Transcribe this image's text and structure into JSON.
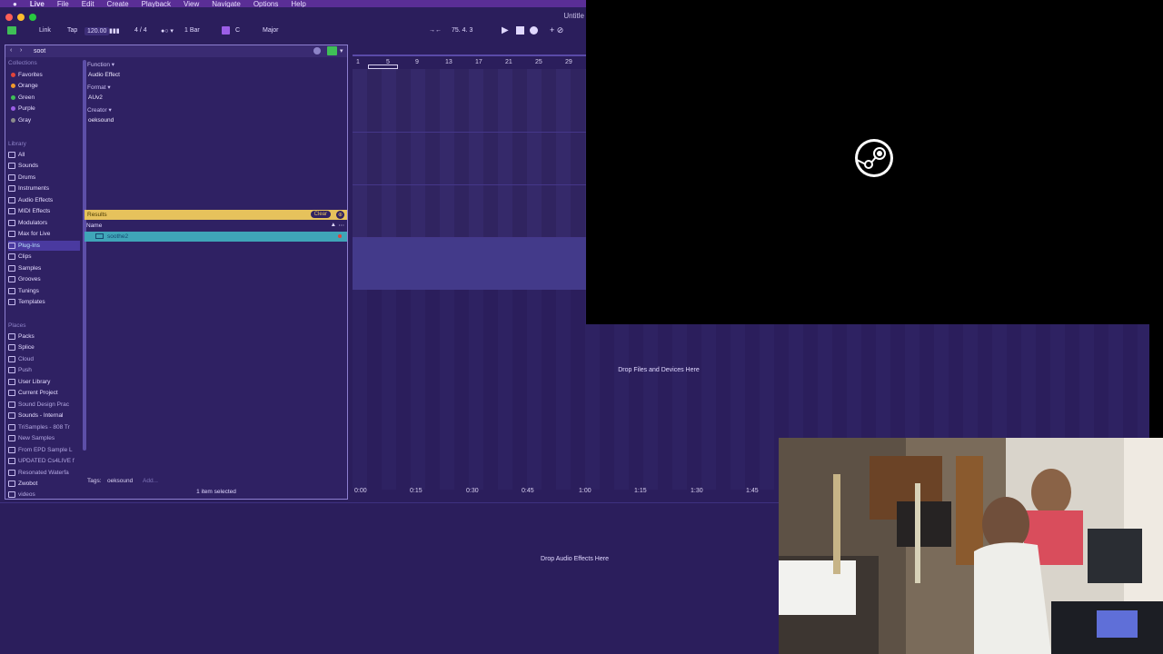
{
  "menubar": {
    "app": "Live",
    "items": [
      "File",
      "Edit",
      "Create",
      "Playback",
      "View",
      "Navigate",
      "Options",
      "Help"
    ]
  },
  "window": {
    "title": "Untitle"
  },
  "transport": {
    "link": "Link",
    "tap": "Tap",
    "tempo": "120.00",
    "signature": "4 / 4",
    "quantize": "1 Bar",
    "key": "C",
    "scale": "Major",
    "position": "75.  4.  3"
  },
  "browser": {
    "search_value": "soot",
    "collections_header": "Collections",
    "collections": [
      {
        "label": "Favorites",
        "color": "#e0443b"
      },
      {
        "label": "Orange",
        "color": "#f09a2c"
      },
      {
        "label": "Green",
        "color": "#3fbf57"
      },
      {
        "label": "Purple",
        "color": "#9b5ee6"
      },
      {
        "label": "Gray",
        "color": "#8b8b8b"
      }
    ],
    "library_header": "Library",
    "library": [
      "All",
      "Sounds",
      "Drums",
      "Instruments",
      "Audio Effects",
      "MIDI Effects",
      "Modulators",
      "Max for Live",
      "Plug-Ins",
      "Clips",
      "Samples",
      "Grooves",
      "Tunings",
      "Templates"
    ],
    "places_header": "Places",
    "places": [
      "Packs",
      "Splice",
      "Cloud",
      "Push",
      "User Library",
      "Current Project",
      "Sound Design Prac",
      "Sounds - Internal",
      "TriSamples - 808 Tr",
      "New Samples",
      "From EPD Sample L",
      "UPDATED Cs4LIVE f",
      "Resonated Waterfa",
      "Zwobot",
      "videos"
    ],
    "filters": {
      "function_label": "Function ▾",
      "function_value": "Audio Effect",
      "format_label": "Format ▾",
      "format_value": "AUv2",
      "creator_label": "Creator ▾",
      "creator_value": "oeksound"
    },
    "results_label": "Results",
    "clear_label": "Clear",
    "column_name": "Name",
    "result_item": "soothe2",
    "tags_label": "Tags:",
    "tag_value": "oeksound",
    "tag_add": "Add...",
    "status": "1 item selected"
  },
  "ruler_bars": [
    "1",
    "5",
    "9",
    "13",
    "17",
    "21",
    "25",
    "29"
  ],
  "time_ruler": [
    "0:00",
    "0:15",
    "0:30",
    "0:45",
    "1:00",
    "1:15",
    "1:30",
    "1:45"
  ],
  "drop_files": "Drop Files and Devices Here",
  "drop_audio": "Drop Audio Effects Here",
  "colors": {
    "accent": "#5a2e96",
    "bg": "#2b1e5c",
    "results": "#e6c25c",
    "selection": "#3fa5b8"
  }
}
